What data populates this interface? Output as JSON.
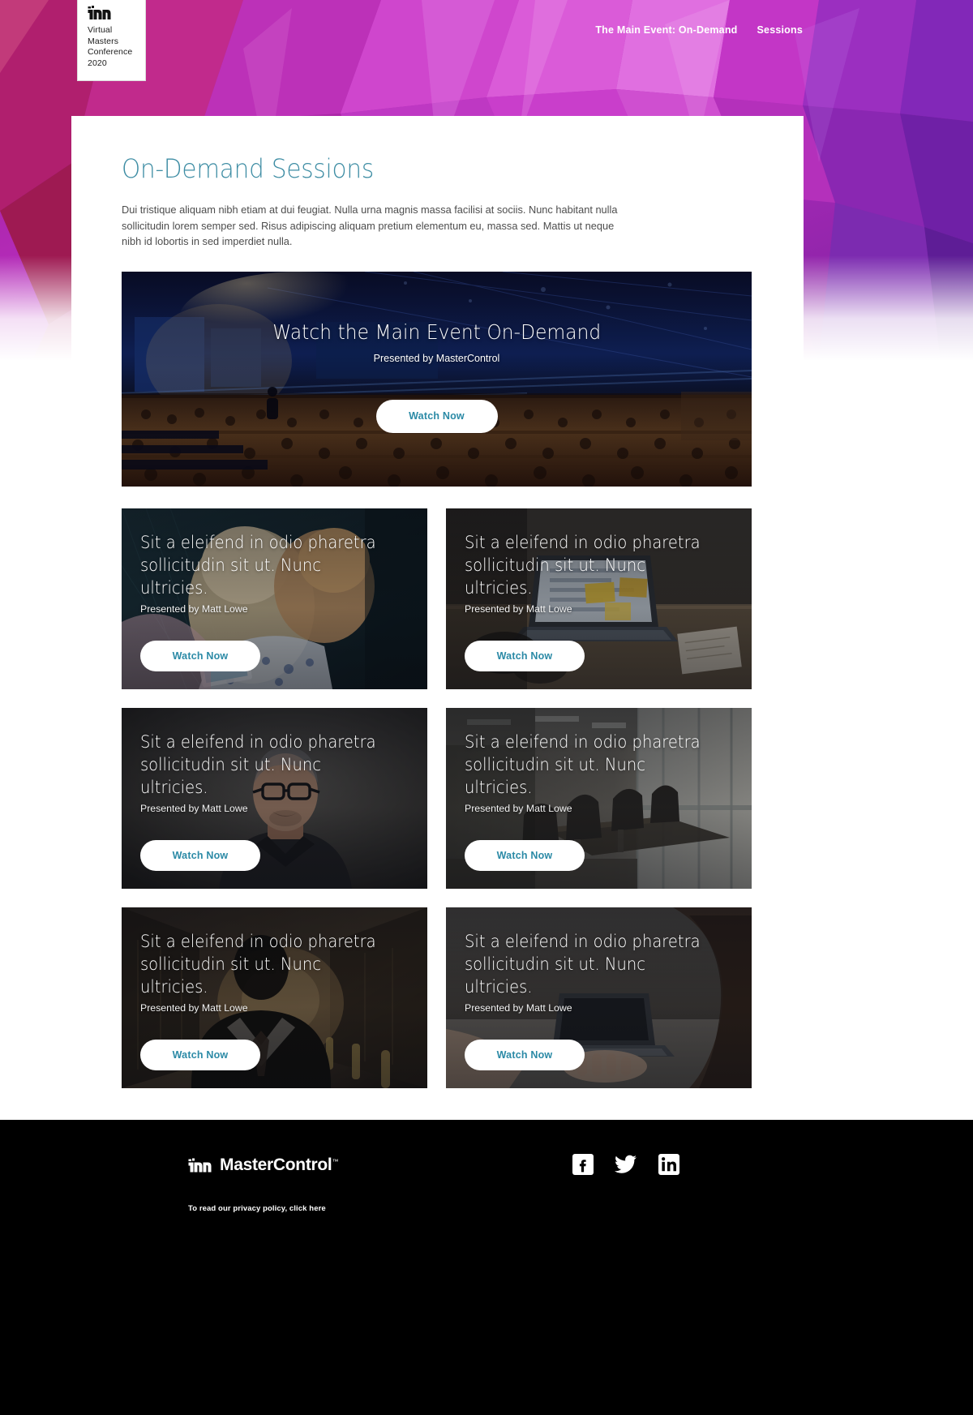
{
  "header": {
    "logo_card": {
      "mark": "mastercontrol-m-icon",
      "line1": "Virtual",
      "line2": "Masters",
      "line3": "Conference",
      "line4": "2020"
    },
    "nav": [
      {
        "label": "The Main Event: On-Demand",
        "name": "nav-main-event"
      },
      {
        "label": "Sessions",
        "name": "nav-sessions"
      }
    ],
    "accent_color": "#a8209a"
  },
  "main": {
    "title": "On-Demand Sessions",
    "title_color": "#3e8da4",
    "intro": "Dui tristique aliquam nibh etiam at dui feugiat. Nulla urna magnis massa facilisi at sociis. Nunc habitant nulla sollicitudin lorem semper sed. Risus adipiscing aliquam pretium elementum eu, massa sed. Mattis ut neque nibh id lobortis in sed imperdiet nulla.",
    "feature": {
      "title": "Watch the Main Event On-Demand",
      "subtitle": "Presented by MasterControl",
      "button_label": "Watch Now",
      "image": "conference-auditorium-crowd"
    },
    "sessions": [
      {
        "title": "Sit a eleifend in odio pharetra sollicitudin sit ut. Nunc ultricies.",
        "subtitle": "Presented by Matt Lowe",
        "button_label": "Watch Now",
        "image": "mother-child-tablet"
      },
      {
        "title": "Sit a eleifend in odio pharetra sollicitudin sit ut. Nunc ultricies.",
        "subtitle": "Presented by Matt Lowe",
        "button_label": "Watch Now",
        "image": "laptop-desk-workspace"
      },
      {
        "title": "Sit a eleifend in odio pharetra sollicitudin sit ut. Nunc ultricies.",
        "subtitle": "Presented by Matt Lowe",
        "button_label": "Watch Now",
        "image": "man-glasses-portrait"
      },
      {
        "title": "Sit a eleifend in odio pharetra sollicitudin sit ut. Nunc ultricies.",
        "subtitle": "Presented by Matt Lowe",
        "button_label": "Watch Now",
        "image": "empty-boardroom-chairs"
      },
      {
        "title": "Sit a eleifend in odio pharetra sollicitudin sit ut. Nunc ultricies.",
        "subtitle": "Presented by Matt Lowe",
        "button_label": "Watch Now",
        "image": "man-suit-tie-street"
      },
      {
        "title": "Sit a eleifend in odio pharetra sollicitudin sit ut. Nunc ultricies.",
        "subtitle": "Presented by Matt Lowe",
        "button_label": "Watch Now",
        "image": "woman-typing-laptop"
      }
    ]
  },
  "footer": {
    "brand": "MasterControl",
    "trademark": "™",
    "privacy_label": "To read our privacy policy, click here",
    "social": [
      {
        "name": "facebook-icon",
        "label": "Facebook"
      },
      {
        "name": "twitter-icon",
        "label": "Twitter"
      },
      {
        "name": "linkedin-icon",
        "label": "LinkedIn"
      }
    ],
    "background_color": "#000000"
  }
}
